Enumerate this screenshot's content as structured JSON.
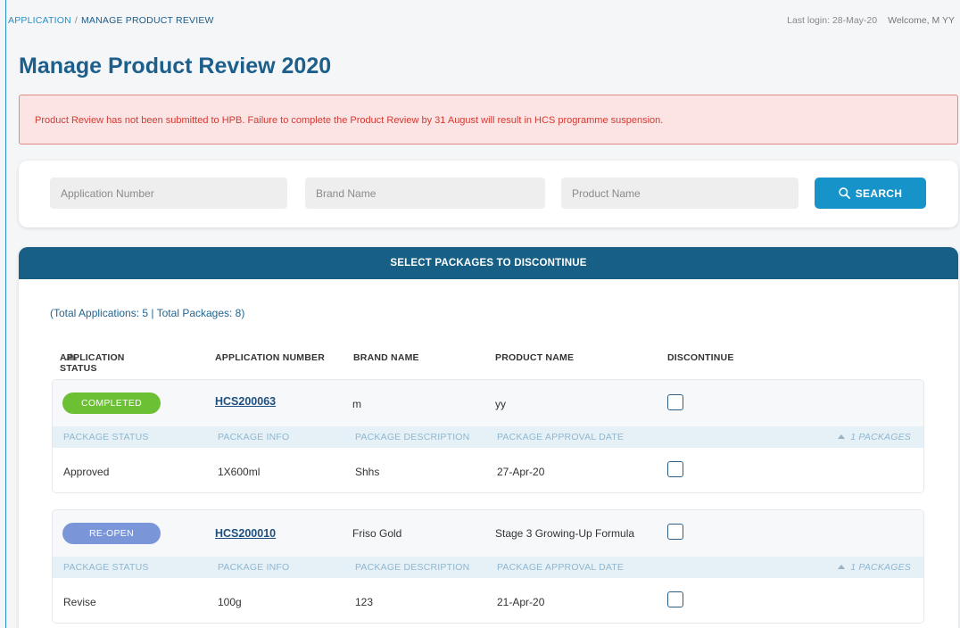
{
  "breadcrumb": {
    "root": "APPLICATION",
    "separator": "/",
    "current": "MANAGE PRODUCT REVIEW"
  },
  "user": {
    "last_login": "Last login: 28-May-20",
    "welcome": "Welcome, M YY"
  },
  "page_title": "Manage Product Review 2020",
  "alert": {
    "text": "Product Review has not been submitted to HPB. Failure to complete the Product Review by 31 August will result in HCS programme suspension.",
    "color": "#d33a33"
  },
  "search": {
    "application_number_placeholder": "Application Number",
    "brand_name_placeholder": "Brand Name",
    "product_name_placeholder": "Product Name",
    "button_label": "SEARCH",
    "button_icon": "search-icon"
  },
  "results": {
    "header": "SELECT PACKAGES TO DISCONTINUE",
    "totals": "(Total Applications: 5 | Total Packages: 8)",
    "columns": {
      "status": "APPLICATION STATUS",
      "app_number": "APPLICATION NUMBER",
      "brand": "BRAND NAME",
      "product": "PRODUCT NAME",
      "discontinue": "DISCONTINUE"
    },
    "package_columns": {
      "status": "PACKAGE STATUS",
      "info": "PACKAGE INFO",
      "description": "PACKAGE DESCRIPTION",
      "approval_date": "PACKAGE APPROVAL DATE"
    },
    "applications": [
      {
        "status": "COMPLETED",
        "status_color": "#6cc033",
        "app_number": "HCS200063",
        "brand": "m",
        "product": "yy",
        "package_count": "1 PACKAGES",
        "package": {
          "status": "Approved",
          "info": "1X600ml",
          "description": "Shhs",
          "approval_date": "27-Apr-20"
        }
      },
      {
        "status": "RE-OPEN",
        "status_color": "#7a95d8",
        "app_number": "HCS200010",
        "brand": "Friso Gold",
        "product": "Stage 3 Growing-Up Formula",
        "package_count": "1 PACKAGES",
        "package": {
          "status": "Revise",
          "info": "100g",
          "description": "123",
          "approval_date": "21-Apr-20"
        }
      }
    ]
  },
  "colors": {
    "primary": "#175f84",
    "accent": "#1693c8",
    "title": "#1d5f8b"
  }
}
